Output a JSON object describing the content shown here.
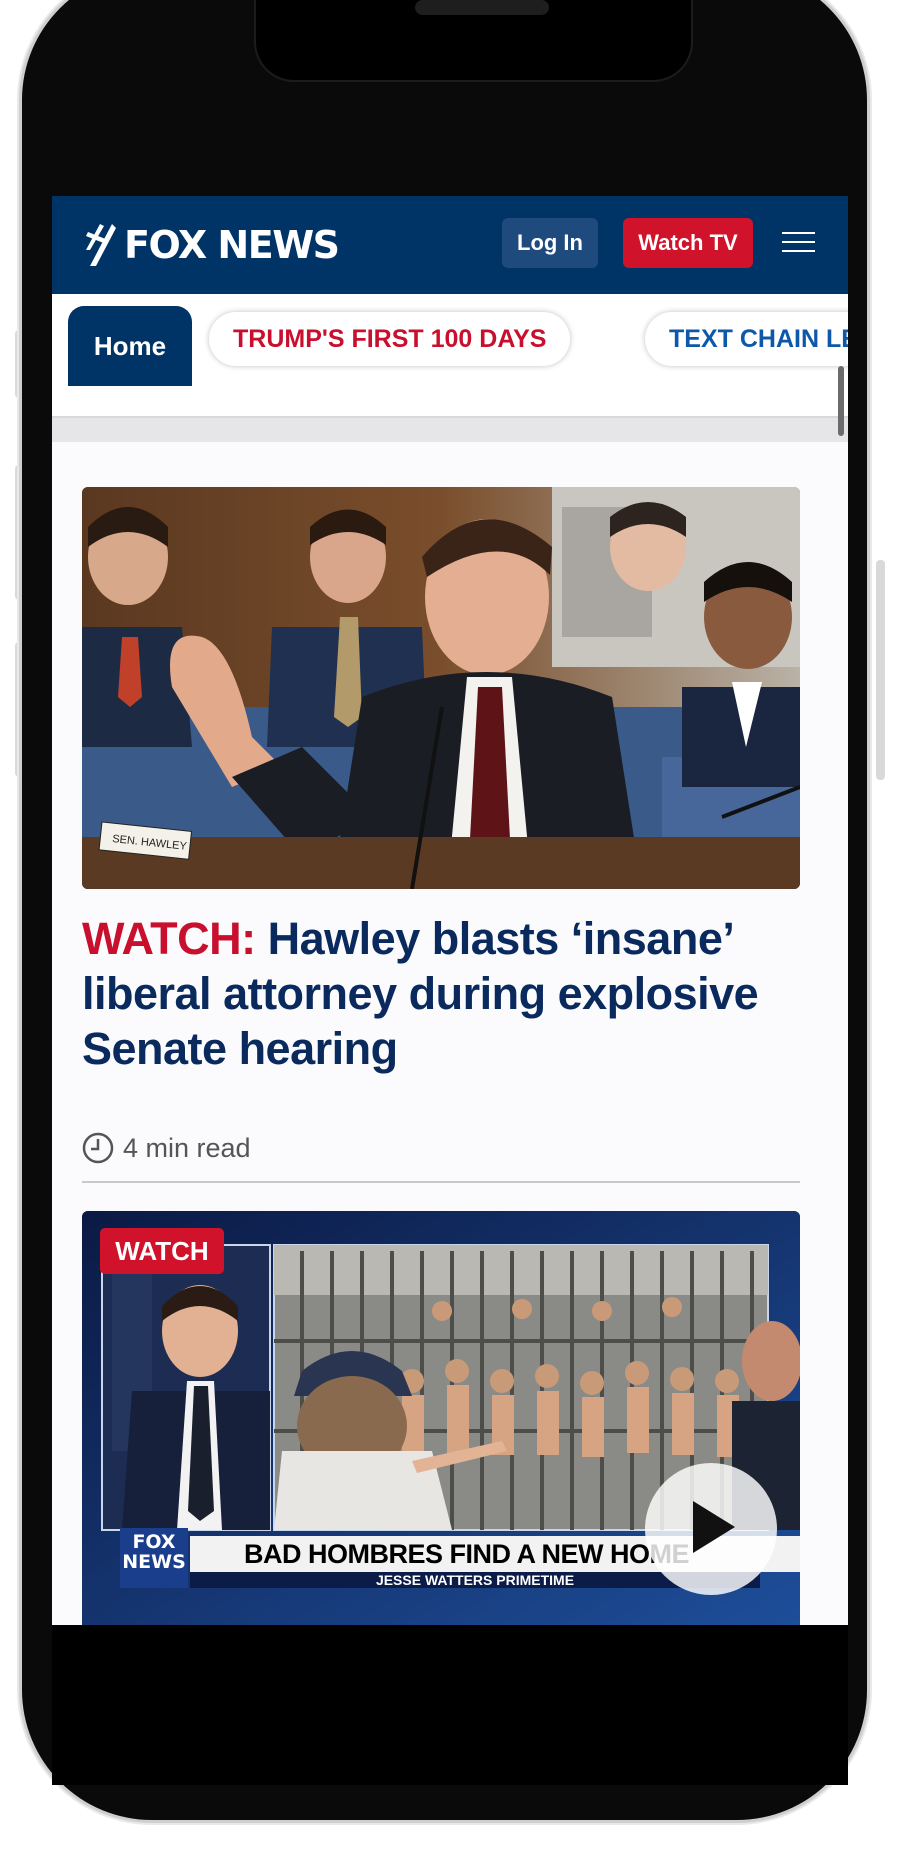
{
  "header": {
    "logo_text": "FOX NEWS",
    "login_label": "Log In",
    "watch_tv_label": "Watch TV"
  },
  "tabs": [
    {
      "label": "Home",
      "active": true
    },
    {
      "label": "TRUMP'S FIRST 100 DAYS",
      "active": false
    },
    {
      "label": "TEXT CHAIN LEA",
      "active": false
    }
  ],
  "article": {
    "kicker": "WATCH:",
    "headline": "Hawley blasts ‘insane’ liberal attorney during explosive Senate hearing",
    "read_time": "4 min read",
    "image_nameplate": "SEN. HAWLEY"
  },
  "video": {
    "badge": "WATCH",
    "lower_third_logo": "FOX NEWS",
    "lower_third_headline": "BAD HOMBRES FIND A NEW HOME",
    "lower_third_sub": "JESSE WATTERS PRIMETIME"
  },
  "colors": {
    "navy": "#003366",
    "red": "#d0122b",
    "link_blue": "#0d58a8",
    "headline": "#0a2a5e"
  }
}
